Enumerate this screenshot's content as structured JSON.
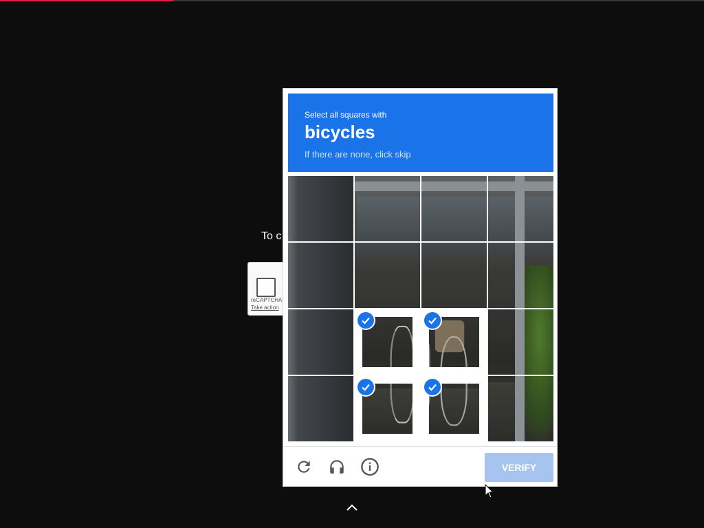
{
  "page": {
    "background_color": "#0e0d0e",
    "progress_color": "#e8194b",
    "behind_text": "To c"
  },
  "anchor": {
    "brand": "reCAPTCHA",
    "link_text": "Take action"
  },
  "challenge": {
    "prompt_line1": "Select all squares with",
    "target": "bicycles",
    "prompt_line3": "If there are none, click skip",
    "header_color": "#1a73e8",
    "grid_size": 4,
    "tiles": [
      {
        "id": 1,
        "selected": false
      },
      {
        "id": 2,
        "selected": false
      },
      {
        "id": 3,
        "selected": false
      },
      {
        "id": 4,
        "selected": false
      },
      {
        "id": 5,
        "selected": false
      },
      {
        "id": 6,
        "selected": false
      },
      {
        "id": 7,
        "selected": false
      },
      {
        "id": 8,
        "selected": false
      },
      {
        "id": 9,
        "selected": false
      },
      {
        "id": 10,
        "selected": true
      },
      {
        "id": 11,
        "selected": true
      },
      {
        "id": 12,
        "selected": false
      },
      {
        "id": 13,
        "selected": false
      },
      {
        "id": 14,
        "selected": true
      },
      {
        "id": 15,
        "selected": true
      },
      {
        "id": 16,
        "selected": false
      }
    ],
    "footer": {
      "reload_icon": "reload-icon",
      "audio_icon": "headphones-icon",
      "info_icon": "info-icon",
      "verify_label": "VERIFY",
      "verify_color": "#a7c4ee"
    }
  }
}
